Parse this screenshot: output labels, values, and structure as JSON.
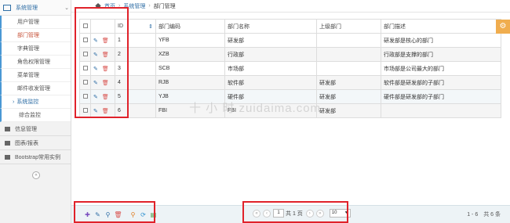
{
  "sidebar": {
    "top_label": "系统管理",
    "items": [
      {
        "label": "用户管理",
        "active": false
      },
      {
        "label": "部门管理",
        "active": true
      },
      {
        "label": "字典管理",
        "active": false
      },
      {
        "label": "角色权限管理",
        "active": false
      },
      {
        "label": "菜单管理",
        "active": false
      },
      {
        "label": "邮件收发管理",
        "active": false
      }
    ],
    "group_label": "系统监控",
    "deep_item": "综合监控",
    "sections": [
      "信息管理",
      "图表/报表",
      "Bootstrap常用实例"
    ],
    "collapse_glyph": "«"
  },
  "breadcrumb": {
    "home": "首页",
    "parent": "系统管理",
    "current": "部门管理",
    "sep": "›"
  },
  "table": {
    "headers": {
      "check": "",
      "actions": "",
      "id": "ID",
      "code": "部门编码",
      "name": "部门名称",
      "parent": "上级部门",
      "desc": "部门描述"
    },
    "rows": [
      {
        "id": "1",
        "code": "YFB",
        "name": "研发部",
        "parent": "",
        "desc": "研发部是核心的部门"
      },
      {
        "id": "2",
        "code": "XZB",
        "name": "行政部",
        "parent": "",
        "desc": "行政部是支撑的部门"
      },
      {
        "id": "3",
        "code": "SCB",
        "name": "市场部",
        "parent": "",
        "desc": "市场部是公司最大的部门"
      },
      {
        "id": "4",
        "code": "RJB",
        "name": "软件部",
        "parent": "研发部",
        "desc": "软件部是研发部的子部门"
      },
      {
        "id": "5",
        "code": "YJB",
        "name": "硬件部",
        "parent": "研发部",
        "desc": "硬件部是研发部的子部门"
      },
      {
        "id": "6",
        "code": "FBI",
        "name": "FBI",
        "parent": "研发部",
        "desc": ""
      }
    ]
  },
  "watermark": "十 小 时  zuidaima.com",
  "pager": {
    "page_value": "1",
    "total_pages": "共 1 页",
    "page_size": "10"
  },
  "record_info": "1 - 6　共 6 条",
  "icons": {
    "pen": "✎",
    "del": "🗑",
    "gear": "⚙",
    "add": "✚",
    "search": "⚲",
    "refresh": "⟳",
    "export": "▤",
    "sort": "⇕"
  },
  "colors": {
    "accent": "#2f6ea5",
    "danger": "#d9534f",
    "highlight": "#e0222a",
    "warning": "#f0ad4e"
  }
}
